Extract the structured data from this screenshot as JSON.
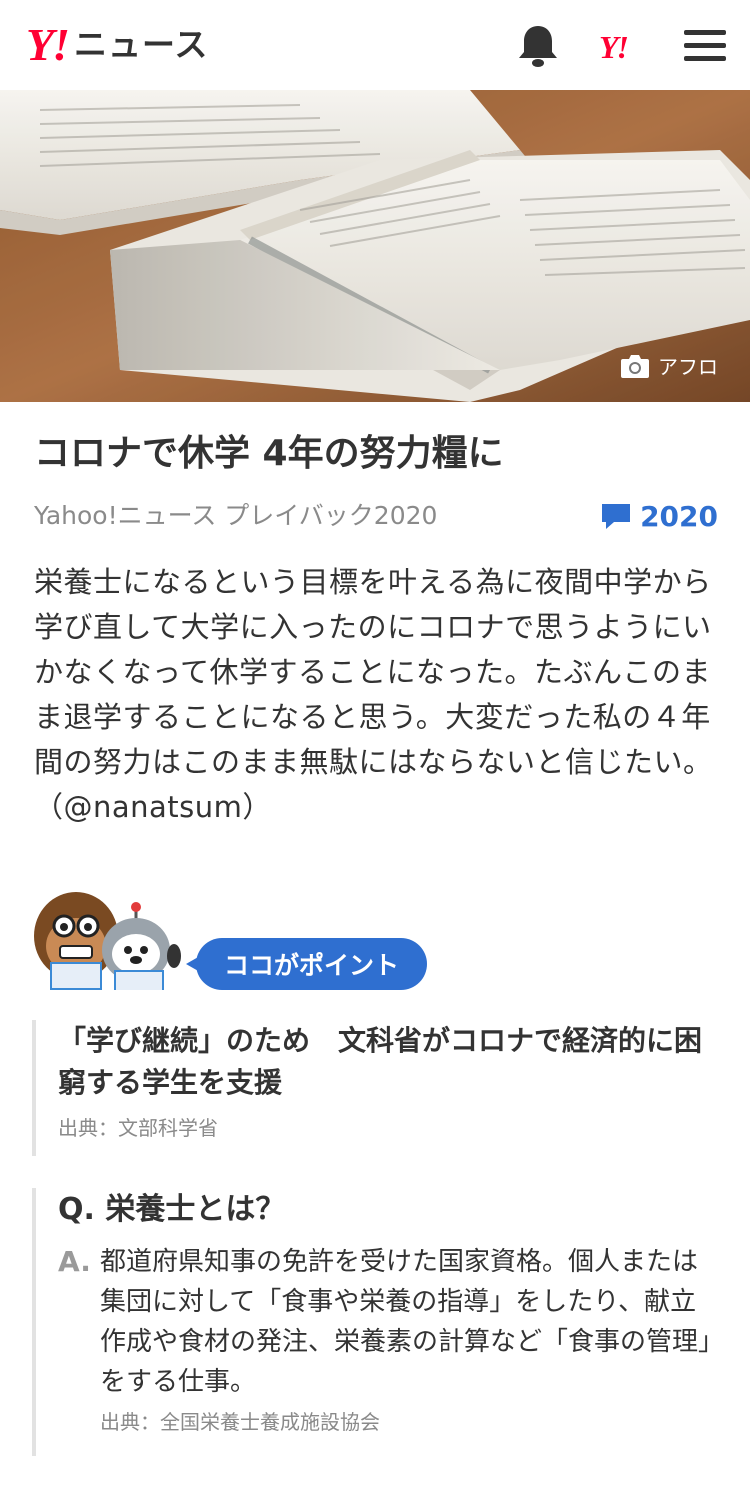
{
  "header": {
    "logo_y": "Y!",
    "logo_news": "ニュース",
    "yahoo_icon": "Y!",
    "icons": [
      "bell-icon",
      "yahoo-icon",
      "menu-icon"
    ]
  },
  "hero": {
    "credit": "アフロ",
    "camera_icon": "camera-icon"
  },
  "article": {
    "title": "コロナで休学 4年の努力糧に",
    "source": "Yahoo!ニュース プレイバック2020",
    "comment_count": "2020",
    "comment_icon": "comment-bubble-icon",
    "accent_color": "#2f6fd0",
    "lead": "栄養士になるという目標を叶える為に夜間中学から学び直して大学に入ったのにコロナで思うようにいかなくなって休学することになった。たぶんこのまま退学することになると思う。大変だった私の４年間の努力はこのまま無駄にはならないと信じたい。（@nanatsum）"
  },
  "point": {
    "badge": "ココがポイント",
    "item_title": "「学び継続」のため　文科省がコロナで経済的に困窮する学生を支援",
    "item_source": "出典：文部科学省"
  },
  "qa": {
    "question": "Q. 栄養士とは？",
    "answer_letter": "A.",
    "answer": "都道府県知事の免許を受けた国家資格。個人または集団に対して「食事や栄養の指導」をしたり、献立作成や食材の発注、栄養素の計算など「食事の管理」をする仕事。",
    "source": "出典：全国栄養士養成施設協会"
  }
}
